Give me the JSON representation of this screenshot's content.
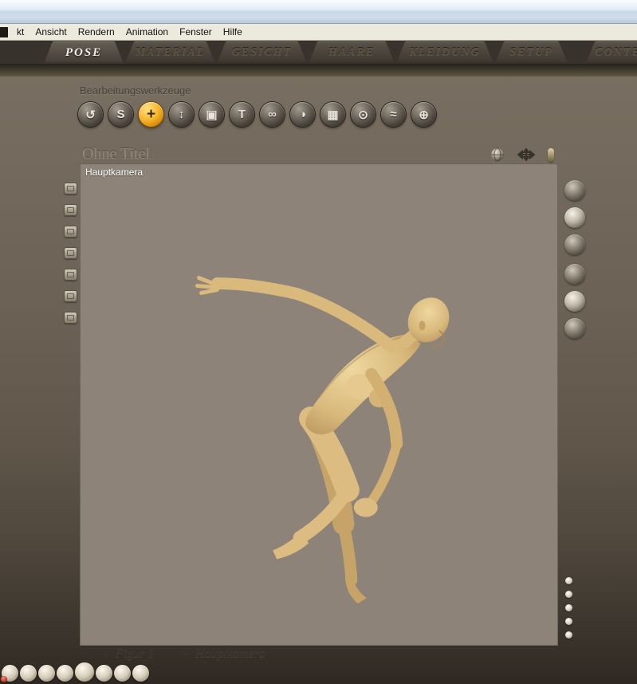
{
  "menu": {
    "items": [
      "kt",
      "Ansicht",
      "Rendern",
      "Animation",
      "Fenster",
      "Hilfe"
    ]
  },
  "tabs": [
    {
      "label": "POSE",
      "active": true
    },
    {
      "label": "MATERIAL",
      "active": false
    },
    {
      "label": "GESICHT",
      "active": false
    },
    {
      "label": "HAARE",
      "active": false
    },
    {
      "label": "KLEIDUNG",
      "active": false
    },
    {
      "label": "SETUP",
      "active": false
    },
    {
      "label": "CONTE",
      "active": false
    }
  ],
  "tools": {
    "section_label": "Bearbeitungswerkzeuge",
    "buttons": [
      {
        "name": "rotate",
        "glyph": "↺",
        "highlighted": false
      },
      {
        "name": "twist",
        "glyph": "S",
        "highlighted": false
      },
      {
        "name": "translate-pull",
        "glyph": "+",
        "highlighted": true
      },
      {
        "name": "translate-in-out",
        "glyph": "↕",
        "highlighted": false
      },
      {
        "name": "scale",
        "glyph": "▣",
        "highlighted": false
      },
      {
        "name": "taper",
        "glyph": "T",
        "highlighted": false
      },
      {
        "name": "chain-break",
        "glyph": "∞",
        "highlighted": false
      },
      {
        "name": "color",
        "glyph": "◑",
        "highlighted": false
      },
      {
        "name": "grouping",
        "glyph": "▦",
        "highlighted": false
      },
      {
        "name": "view-magnifier",
        "glyph": "⊙",
        "highlighted": false
      },
      {
        "name": "morphing-tool",
        "glyph": "≈",
        "highlighted": false
      },
      {
        "name": "direct-manipulation",
        "glyph": "⊕",
        "highlighted": false
      }
    ]
  },
  "document": {
    "title": "Ohne Titel",
    "camera_label": "Hauptkamera"
  },
  "selectors": {
    "figure_label": "Figur 1",
    "camera_label": "Hauptkamera"
  },
  "colors": {
    "accent_gold": "#e8a01a",
    "skin": "#d9b97c",
    "viewport_bg": "#8d8379",
    "workspace_bg": "#6b6155"
  }
}
